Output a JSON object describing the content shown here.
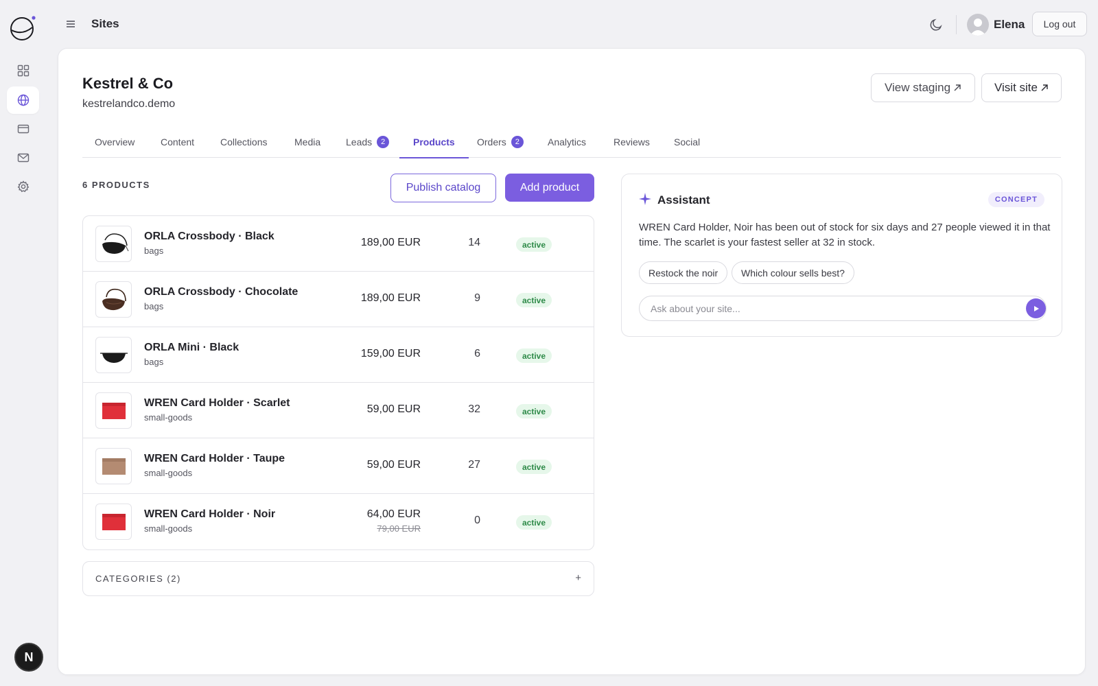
{
  "topbar": {
    "title": "Sites",
    "user_name": "Elena",
    "logout_label": "Log out"
  },
  "rail": {
    "items": [
      {
        "icon": "grid-icon"
      },
      {
        "icon": "globe-icon",
        "active": true
      },
      {
        "icon": "card-icon"
      },
      {
        "icon": "mail-icon"
      },
      {
        "icon": "gear-icon"
      }
    ],
    "avatar_letter": "N"
  },
  "site": {
    "name": "Kestrel & Co",
    "domain": "kestrelandco.demo",
    "view_staging_label": "View staging",
    "visit_site_label": "Visit site"
  },
  "tabs": [
    {
      "label": "Overview"
    },
    {
      "label": "Content"
    },
    {
      "label": "Collections"
    },
    {
      "label": "Media"
    },
    {
      "label": "Leads",
      "badge": "2"
    },
    {
      "label": "Products",
      "active": true
    },
    {
      "label": "Orders",
      "badge": "2"
    },
    {
      "label": "Analytics"
    },
    {
      "label": "Reviews"
    },
    {
      "label": "Social"
    }
  ],
  "products": {
    "count_label": "6 PRODUCTS",
    "publish_label": "Publish catalog",
    "add_label": "Add product",
    "rows": [
      {
        "name": "ORLA Crossbody · Black",
        "category": "bags",
        "price": "189,00 EUR",
        "stock": "14",
        "status": "active",
        "thumb": "black-bag"
      },
      {
        "name": "ORLA Crossbody · Chocolate",
        "category": "bags",
        "price": "189,00 EUR",
        "stock": "9",
        "status": "active",
        "thumb": "brown-bag"
      },
      {
        "name": "ORLA Mini · Black",
        "category": "bags",
        "price": "159,00 EUR",
        "stock": "6",
        "status": "active",
        "thumb": "black-mini"
      },
      {
        "name": "WREN Card Holder · Scarlet",
        "category": "small-goods",
        "price": "59,00 EUR",
        "stock": "32",
        "status": "active",
        "thumb": "red-card"
      },
      {
        "name": "WREN Card Holder · Taupe",
        "category": "small-goods",
        "price": "59,00 EUR",
        "stock": "27",
        "status": "active",
        "thumb": "taupe-card"
      },
      {
        "name": "WREN Card Holder · Noir",
        "category": "small-goods",
        "price": "64,00 EUR",
        "old_price": "79,00 EUR",
        "stock": "0",
        "status": "active",
        "thumb": "red-card"
      }
    ],
    "categories_label": "CATEGORIES (2)",
    "categories_toggle": "+"
  },
  "assistant": {
    "title": "Assistant",
    "tag": "CONCEPT",
    "message": "WREN Card Holder, Noir has been out of stock for six days and 27 people viewed it in that time. The scarlet is your fastest seller at 32 in stock.",
    "chips": [
      "Restock the noir",
      "Which colour sells best?"
    ],
    "input_placeholder": "Ask about your site..."
  },
  "colors": {
    "accent": "#7b5ee0",
    "status_active_bg": "#e6f7ea",
    "status_active_fg": "#2e8a48"
  }
}
